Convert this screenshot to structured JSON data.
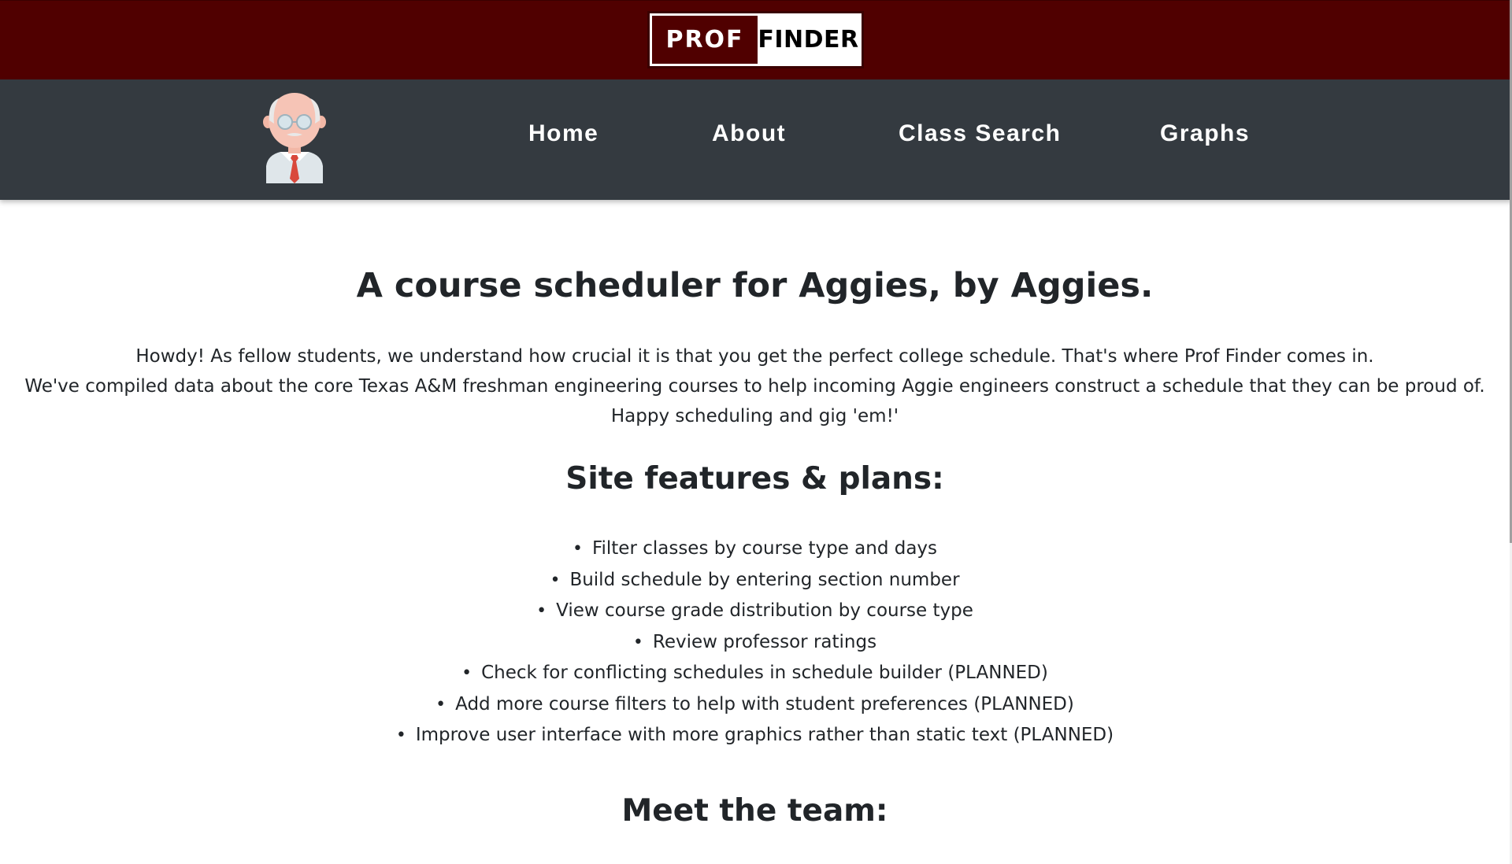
{
  "logo": {
    "left_text": "PROF",
    "right_text": "FINDER"
  },
  "nav": {
    "items": [
      {
        "label": "Home"
      },
      {
        "label": "About"
      },
      {
        "label": "Class Search"
      },
      {
        "label": "Graphs"
      }
    ]
  },
  "avatar_icon": "professor-avatar-icon",
  "main": {
    "headline": "A course scheduler for Aggies, by Aggies.",
    "intro_lines": [
      "Howdy! As fellow students, we understand how crucial it is that you get the perfect college schedule. That's where Prof Finder comes in.",
      "We've compiled data about the core Texas A&M freshman engineering courses to help incoming Aggie engineers construct a schedule that they can be proud of.",
      "Happy scheduling and gig 'em!'"
    ],
    "features_heading": "Site features & plans:",
    "features": [
      "Filter classes by course type and days",
      "Build schedule by entering section number",
      "View course grade distribution by course type",
      "Review professor ratings",
      "Check for conflicting schedules in schedule builder (PLANNED)",
      "Add more course filters to help with student preferences (PLANNED)",
      "Improve user interface with more graphics rather than static text (PLANNED)"
    ],
    "team_heading": "Meet the team:"
  },
  "colors": {
    "banner": "#500000",
    "navbar": "#343a40",
    "text": "#212529"
  }
}
